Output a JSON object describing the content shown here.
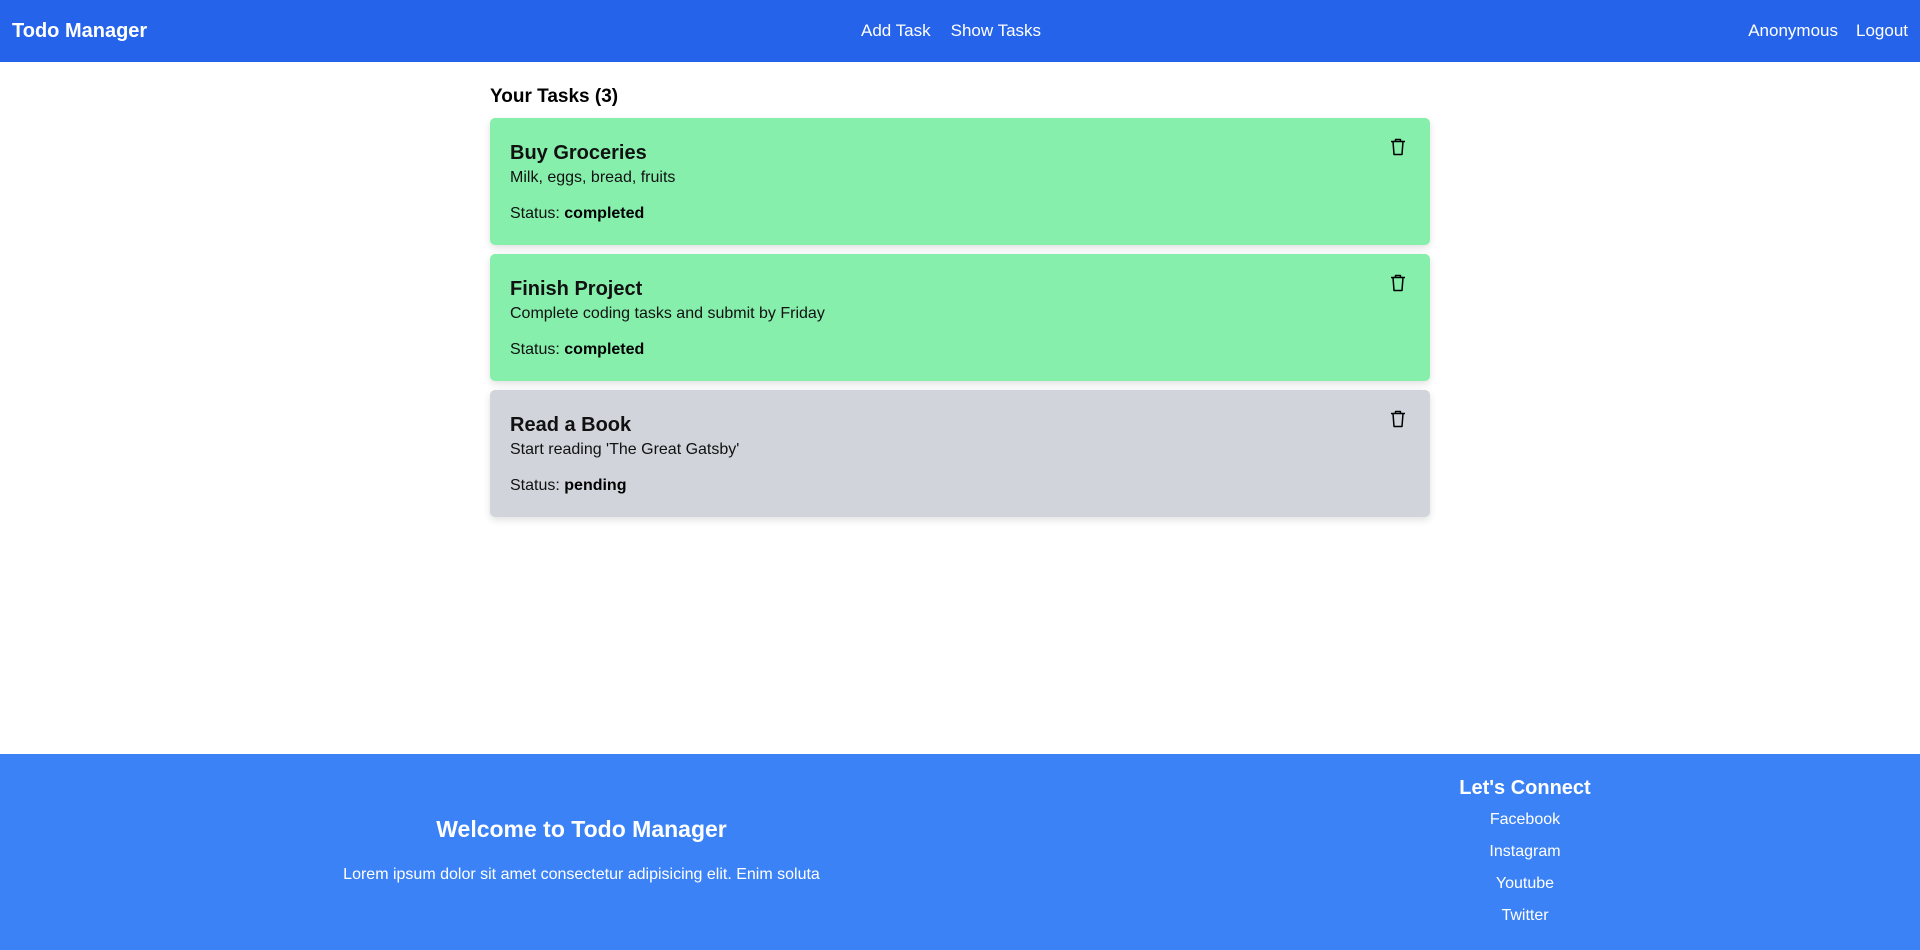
{
  "colors": {
    "navbar_bg": "#2563eb",
    "footer_bg": "#3b82f6",
    "completed_card_bg": "#86efac",
    "pending_card_bg": "#d1d5db"
  },
  "navbar": {
    "brand": "Todo Manager",
    "links": [
      "Add Task",
      "Show Tasks"
    ],
    "user": "Anonymous",
    "logout": "Logout"
  },
  "main": {
    "title": "Your Tasks (3)",
    "status_label": "Status:",
    "tasks": [
      {
        "title": "Buy Groceries",
        "description": "Milk, eggs, bread, fruits",
        "status": "completed",
        "icon": "trash-icon"
      },
      {
        "title": "Finish Project",
        "description": "Complete coding tasks and submit by Friday",
        "status": "completed",
        "icon": "trash-icon"
      },
      {
        "title": "Read a Book",
        "description": "Start reading 'The Great Gatsby'",
        "status": "pending",
        "icon": "trash-icon"
      }
    ]
  },
  "footer": {
    "heading": "Welcome to Todo Manager",
    "text": "Lorem ipsum dolor sit amet consectetur adipisicing elit. Enim soluta",
    "connect_heading": "Let's Connect",
    "social_links": [
      "Facebook",
      "Instagram",
      "Youtube",
      "Twitter"
    ]
  }
}
